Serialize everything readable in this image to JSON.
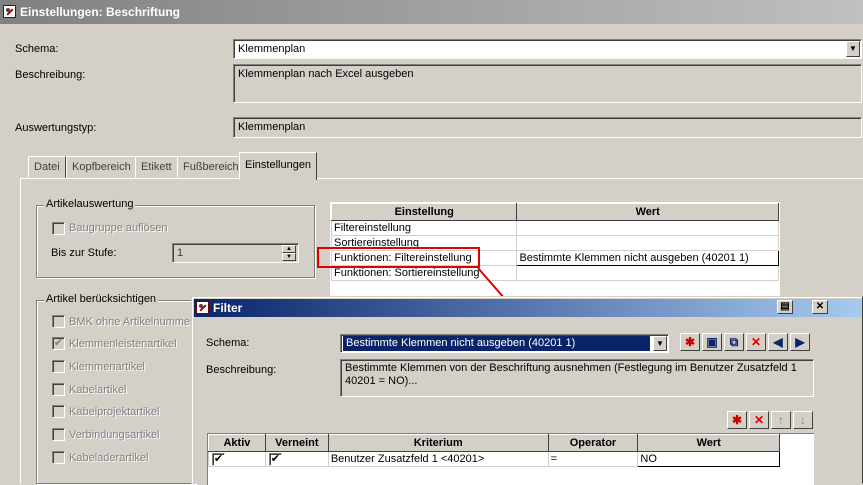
{
  "window": {
    "title": "Einstellungen: Beschriftung",
    "icon": "app-logo-icon"
  },
  "form": {
    "schema_label": "Schema:",
    "schema_value": "Klemmenplan",
    "beschreibung_label": "Beschreibung:",
    "beschreibung_value": "Klemmenplan nach Excel ausgeben",
    "auswertungstyp_label": "Auswertungstyp:",
    "auswertungstyp_value": "Klemmenplan"
  },
  "tabs": [
    {
      "label": "Datei"
    },
    {
      "label": "Kopfbereich"
    },
    {
      "label": "Etikett"
    },
    {
      "label": "Fußbereich"
    },
    {
      "label": "Einstellungen",
      "active": true
    }
  ],
  "artikelauswertung": {
    "title": "Artikelauswertung",
    "baugruppe_label": "Baugruppe auflösen",
    "bis_label": "Bis zur Stufe:",
    "bis_value": "1"
  },
  "artikel_beruecksichtigen": {
    "title": "Artikel berücksichtigen",
    "items": [
      {
        "label": "BMK ohne Artikelnummer",
        "checked": false
      },
      {
        "label": "Klemmenleistenartikel",
        "checked": true
      },
      {
        "label": "Klemmenartikel",
        "checked": false
      },
      {
        "label": "Kabelartikel",
        "checked": false
      },
      {
        "label": "Kabelprojektartikel",
        "checked": false
      },
      {
        "label": "Verbindungsartikel",
        "checked": false
      },
      {
        "label": "Kabeladerartikel",
        "checked": false
      }
    ]
  },
  "settings_grid": {
    "headers": [
      "Einstellung",
      "Wert"
    ],
    "rows": [
      {
        "einstellung": "Filtereinstellung",
        "wert": ""
      },
      {
        "einstellung": "Sortiereinstellung",
        "wert": ""
      },
      {
        "einstellung": "Funktionen: Filtereinstellung",
        "wert": "Bestimmte Klemmen nicht ausgeben (40201 1)"
      },
      {
        "einstellung": "Funktionen: Sortiereinstellung",
        "wert": ""
      }
    ]
  },
  "annotation": {
    "color": "#e00000"
  },
  "filter_dialog": {
    "title": "Filter",
    "schema_label": "Schema:",
    "schema_value": "Bestimmte Klemmen nicht ausgeben (40201 1)",
    "beschreibung_label": "Beschreibung:",
    "beschreibung_value": "Bestimmte Klemmen von der Beschriftung ausnehmen (Festlegung im Benutzer Zusatzfeld 1 40201 = NO)...",
    "toolbar_icons": [
      "new-icon",
      "save-icon",
      "copy-icon",
      "delete-icon",
      "import-icon",
      "export-icon"
    ],
    "grid_toolbar_icons": [
      "new-row-icon",
      "delete-row-icon",
      "move-up-icon",
      "move-down-icon"
    ],
    "grid": {
      "headers": [
        "Aktiv",
        "Verneint",
        "Kriterium",
        "Operator",
        "Wert"
      ],
      "rows": [
        {
          "aktiv": true,
          "verneint": true,
          "kriterium": "Benutzer Zusatzfeld 1 <40201>",
          "operator": "=",
          "wert": "NO"
        }
      ]
    }
  },
  "colors": {
    "face": "#d4d0c8",
    "dialog_title": "#0a246a",
    "inactive_title": "#808080"
  }
}
